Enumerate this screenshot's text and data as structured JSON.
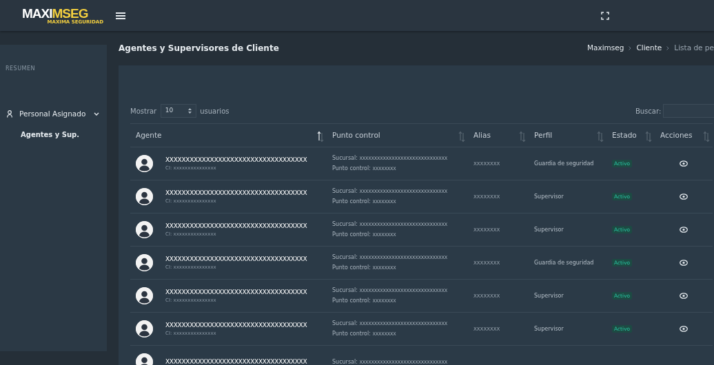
{
  "topbar": {
    "logo_main": "MAXIMSEG",
    "logo_sub": "MAXIMA SEGURIDAD"
  },
  "sidebar": {
    "section": "RESUMEN",
    "items": [
      {
        "label": "Personal Asignado",
        "expanded": true,
        "children": [
          {
            "label": "Agentes y Sup.",
            "selected": true
          }
        ]
      }
    ]
  },
  "page": {
    "title": "Agentes y Supervisores de Cliente",
    "breadcrumb": [
      {
        "label": "Maximseg"
      },
      {
        "label": "Cliente"
      },
      {
        "label": "Lista de pe"
      }
    ]
  },
  "table_controls": {
    "show_label": "Mostrar",
    "page_size": "10",
    "show_suffix": "usuarios",
    "search_label": "Buscar:"
  },
  "table": {
    "columns": [
      {
        "label": "Agente",
        "sorted": true
      },
      {
        "label": "Punto control",
        "sorted": false
      },
      {
        "label": "Alias",
        "sorted": false
      },
      {
        "label": "Perfil",
        "sorted": false
      },
      {
        "label": "Estado",
        "sorted": false
      },
      {
        "label": "Acciones",
        "sorted": false
      }
    ],
    "rows": [
      {
        "name": "XXXXXXXXXXXXXXXXXXXXXXXXXXXXXXXXXXX",
        "ci": "CI: xxxxxxxxxxxxxxx",
        "sucursal_label": "Sucursal:",
        "sucursal": "XXXXXXXXXXXXXXXXXXXXXXXXXXXXXX",
        "punto_label": "Punto control:",
        "punto": "XXXXXXXX",
        "alias": "XXXXXXXX",
        "perfil": "Guardia de seguridad",
        "estado": "Activo"
      },
      {
        "name": "XXXXXXXXXXXXXXXXXXXXXXXXXXXXXXXXXXX",
        "ci": "CI: xxxxxxxxxxxxxxx",
        "sucursal_label": "Sucursal:",
        "sucursal": "XXXXXXXXXXXXXXXXXXXXXXXXXXXXXX",
        "punto_label": "Punto control:",
        "punto": "XXXXXXXX",
        "alias": "XXXXXXXX",
        "perfil": "Supervisor",
        "estado": "Activo"
      },
      {
        "name": "XXXXXXXXXXXXXXXXXXXXXXXXXXXXXXXXXXX",
        "ci": "CI: xxxxxxxxxxxxxxx",
        "sucursal_label": "Sucursal:",
        "sucursal": "XXXXXXXXXXXXXXXXXXXXXXXXXXXXXX",
        "punto_label": "Punto control:",
        "punto": "XXXXXXXX",
        "alias": "XXXXXXXX",
        "perfil": "Supervisor",
        "estado": "Activo"
      },
      {
        "name": "XXXXXXXXXXXXXXXXXXXXXXXXXXXXXXXXXXX",
        "ci": "CI: xxxxxxxxxxxxxxx",
        "sucursal_label": "Sucursal:",
        "sucursal": "XXXXXXXXXXXXXXXXXXXXXXXXXXXXXX",
        "punto_label": "Punto control:",
        "punto": "XXXXXXXX",
        "alias": "XXXXXXXX",
        "perfil": "Guardia de seguridad",
        "estado": "Activo"
      },
      {
        "name": "XXXXXXXXXXXXXXXXXXXXXXXXXXXXXXXXXXX",
        "ci": "CI: xxxxxxxxxxxxxxx",
        "sucursal_label": "Sucursal:",
        "sucursal": "XXXXXXXXXXXXXXXXXXXXXXXXXXXXXX",
        "punto_label": "Punto control:",
        "punto": "XXXXXXXX",
        "alias": "XXXXXXXX",
        "perfil": "Supervisor",
        "estado": "Activo"
      },
      {
        "name": "XXXXXXXXXXXXXXXXXXXXXXXXXXXXXXXXXXX",
        "ci": "CI: xxxxxxxxxxxxxxx",
        "sucursal_label": "Sucursal:",
        "sucursal": "XXXXXXXXXXXXXXXXXXXXXXXXXXXXXX",
        "punto_label": "Punto control:",
        "punto": "XXXXXXXX",
        "alias": "XXXXXXXX",
        "perfil": "Supervisor",
        "estado": "Activo"
      },
      {
        "name": "XXXXXXXXXXXXXXXXXXXXXXXXXXXXXXXXXXX",
        "sucursal_label": "Sucursal:",
        "sucursal": "XXXXXXXXXXXXXXXXXXXXXXXXXXXXXX"
      }
    ]
  }
}
